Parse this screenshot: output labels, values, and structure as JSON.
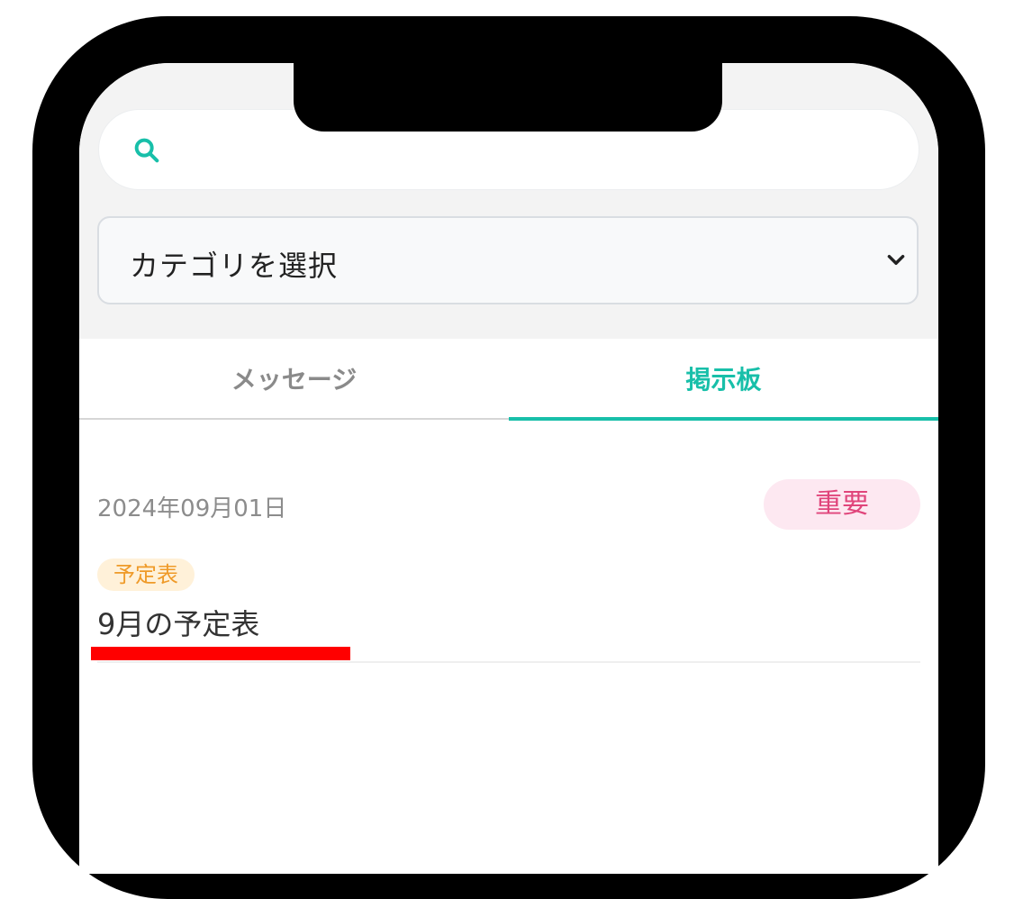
{
  "search": {
    "placeholder": ""
  },
  "category_select": {
    "selected": "カテゴリを選択"
  },
  "tabs": [
    {
      "label": "メッセージ",
      "active": false
    },
    {
      "label": "掲示板",
      "active": true
    }
  ],
  "post": {
    "date": "2024年09月01日",
    "badge": "重要",
    "category_tag": "予定表",
    "title": "9月の予定表"
  },
  "icons": {
    "search": "search-icon",
    "dropdown": "chevron-down-icon"
  },
  "colors": {
    "accent": "#18bfa9",
    "badge_bg": "#fde8f1",
    "badge_text": "#e0457b",
    "tag_bg": "#fff1d9",
    "tag_text": "#ef9a28",
    "highlight": "#ff0000"
  }
}
